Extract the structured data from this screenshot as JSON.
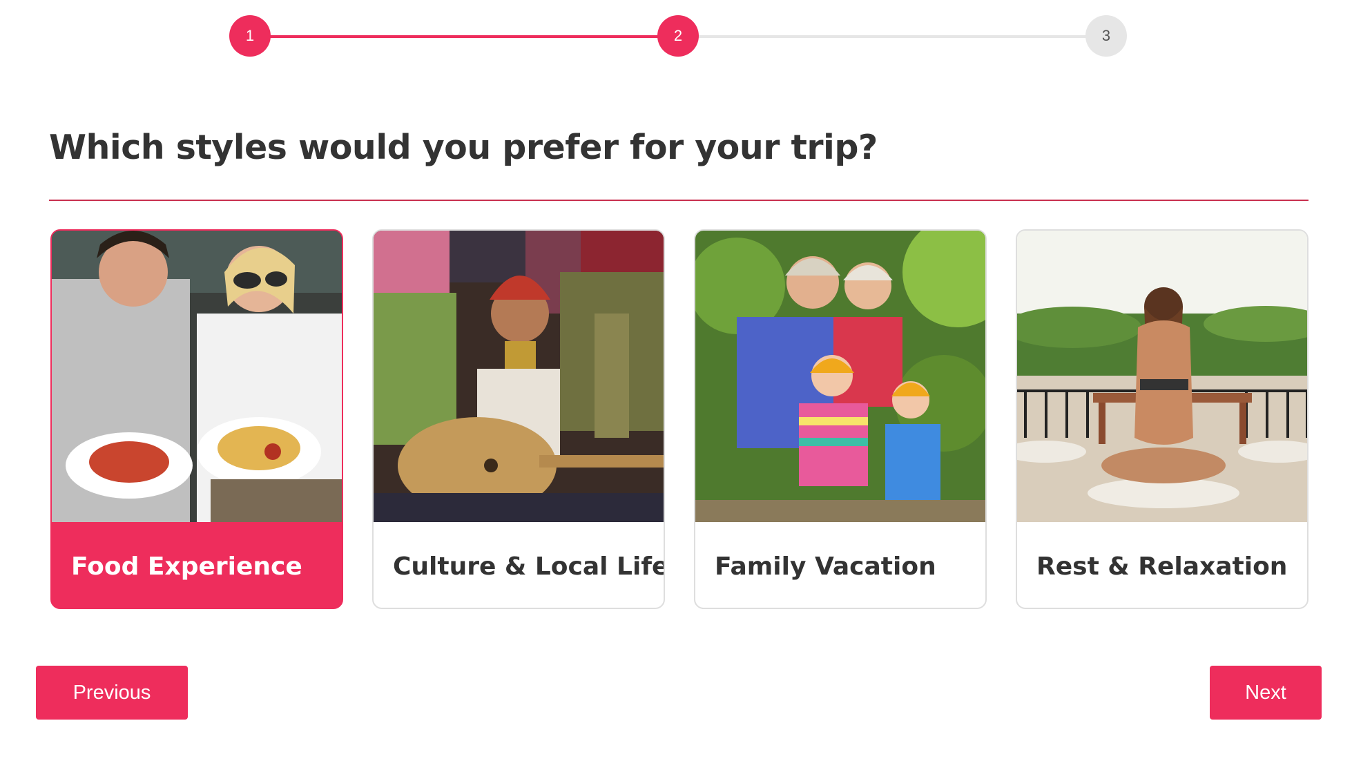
{
  "stepper": {
    "steps": [
      {
        "label": "1",
        "state": "done"
      },
      {
        "label": "2",
        "state": "active"
      },
      {
        "label": "3",
        "state": "pending"
      }
    ]
  },
  "question": {
    "title": "Which styles would you prefer for your trip?"
  },
  "options": [
    {
      "label": "Food Experience",
      "selected": true,
      "image": "couple-holding-food-plates"
    },
    {
      "label": "Culture & Local Life",
      "selected": false,
      "image": "woman-with-guitar-textiles"
    },
    {
      "label": "Family Vacation",
      "selected": false,
      "image": "family-with-helmets-forest"
    },
    {
      "label": "Rest & Relaxation",
      "selected": false,
      "image": "woman-meditating-terrace"
    }
  ],
  "nav": {
    "previous_label": "Previous",
    "next_label": "Next"
  },
  "colors": {
    "accent": "#ee2d5c",
    "inactive_step": "#e6e6e6",
    "text": "#333333"
  }
}
